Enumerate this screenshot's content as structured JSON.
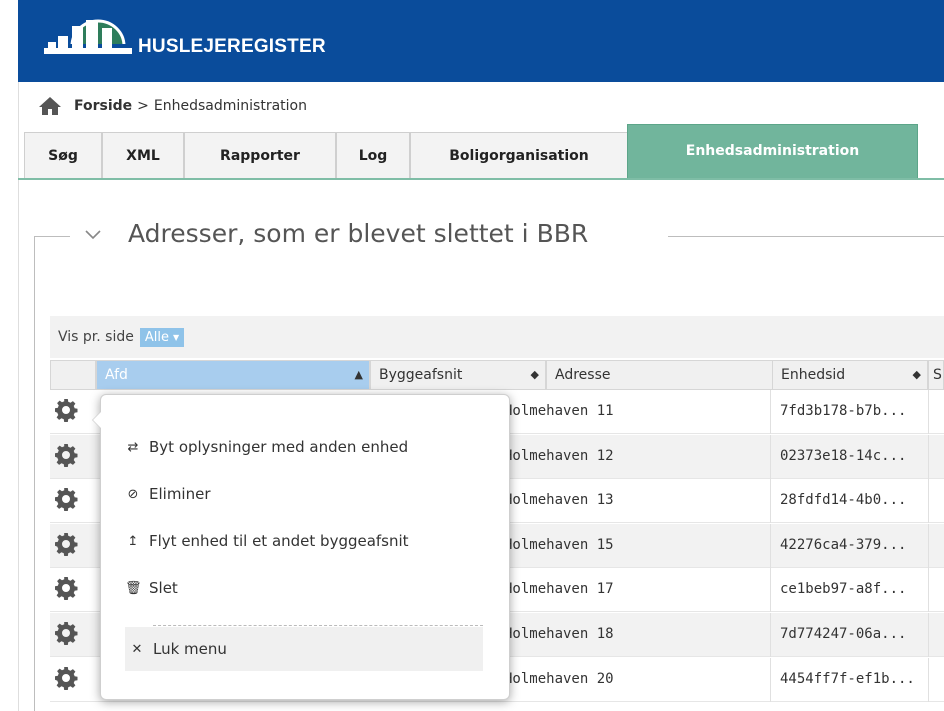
{
  "app": {
    "brand": "HUSLEJEREGISTER"
  },
  "breadcrumb": {
    "home": "Forside",
    "separator": ">",
    "current": "Enhedsadministration"
  },
  "tabs": [
    {
      "label": "Søg",
      "active": false
    },
    {
      "label": "XML",
      "active": false
    },
    {
      "label": "Rapporter",
      "active": false
    },
    {
      "label": "Log",
      "active": false
    },
    {
      "label": "Boligorganisation",
      "active": false
    },
    {
      "label": "Enhedsadministration",
      "active": true
    }
  ],
  "section": {
    "title": "Adresser, som er blevet slettet i BBR"
  },
  "table": {
    "page_size_label": "Vis pr. side",
    "page_size_value": "Alle",
    "columns": [
      "Afd",
      "Byggeafsnit",
      "Adresse",
      "Enhedsid",
      "S"
    ],
    "rows": [
      {
        "adresse": "Holmehaven 11",
        "enhedsid": "7fd3b178-b7b..."
      },
      {
        "adresse": "Holmehaven 12",
        "enhedsid": "02373e18-14c..."
      },
      {
        "adresse": "Holmehaven 13",
        "enhedsid": "28fdfd14-4b0..."
      },
      {
        "adresse": "Holmehaven 15",
        "enhedsid": "42276ca4-379..."
      },
      {
        "adresse": "Holmehaven 17",
        "enhedsid": "ce1beb97-a8f..."
      },
      {
        "adresse": "Holmehaven 18",
        "enhedsid": "7d774247-06a..."
      },
      {
        "adresse": "Holmehaven 20",
        "enhedsid": "4454ff7f-ef1b..."
      }
    ]
  },
  "context_menu": {
    "items": [
      {
        "label": "Byt oplysninger med anden enhed",
        "icon": "swap-icon"
      },
      {
        "label": "Eliminer",
        "icon": "ban-icon"
      },
      {
        "label": "Flyt enhed til et andet byggeafsnit",
        "icon": "move-icon"
      },
      {
        "label": "Slet",
        "icon": "trash-icon"
      }
    ],
    "close_label": "Luk menu"
  },
  "colors": {
    "header_bg": "#0a4c9b",
    "active_tab": "#71b59c",
    "sorted_column": "#a8cdee"
  }
}
